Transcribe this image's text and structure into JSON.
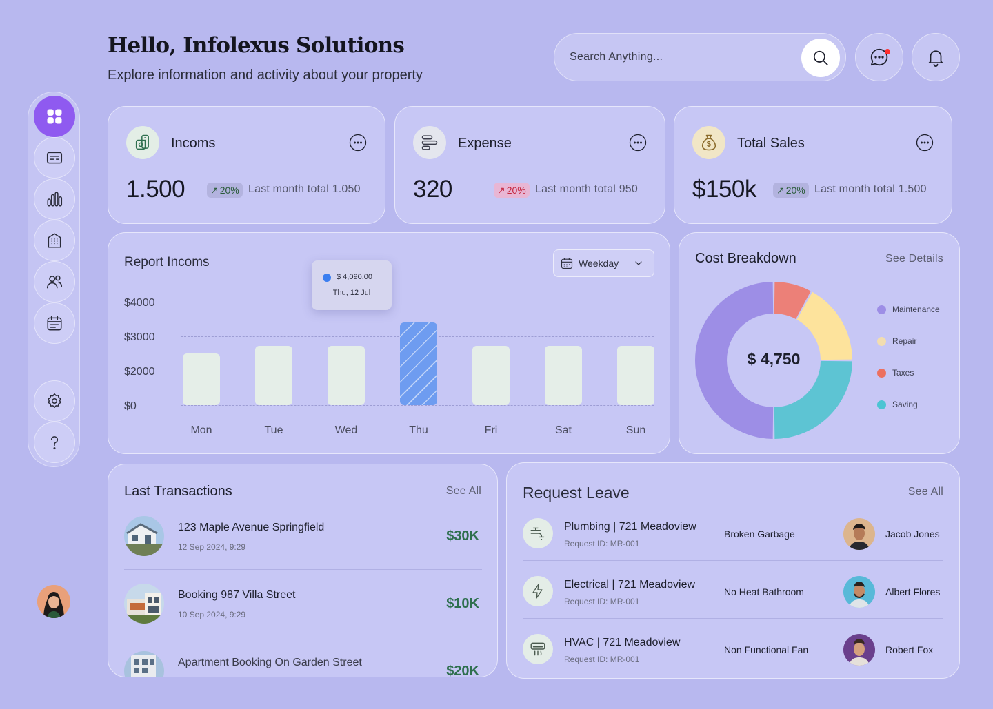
{
  "header": {
    "title": "Hello, Infolexus Solutions",
    "subtitle": "Explore information and activity about your property",
    "search_placeholder": "Search Anything..."
  },
  "sidebar": {
    "items": [
      {
        "icon": "grid-icon",
        "active": true
      },
      {
        "icon": "card-icon"
      },
      {
        "icon": "chart-icon"
      },
      {
        "icon": "building-icon"
      },
      {
        "icon": "users-icon"
      },
      {
        "icon": "calendar-icon"
      }
    ],
    "bottom": [
      {
        "icon": "gear-icon"
      },
      {
        "icon": "help-icon"
      }
    ]
  },
  "stats": [
    {
      "label": "Incoms",
      "value": "1.500",
      "change": "20%",
      "trend": "up",
      "note": "Last month total 1.050"
    },
    {
      "label": "Expense",
      "value": "320",
      "change": "20%",
      "trend": "down",
      "note": "Last month total 950"
    },
    {
      "label": "Total Sales",
      "value": "$150k",
      "change": "20%",
      "trend": "up",
      "note": "Last month total 1.500"
    }
  ],
  "report": {
    "title": "Report Incoms",
    "filter": "Weekday",
    "tooltip": {
      "value": "$ 4,090.00",
      "date": "Thu, 12 Jul"
    }
  },
  "chart_data": {
    "type": "bar",
    "categories": [
      "Mon",
      "Tue",
      "Wed",
      "Thu",
      "Fri",
      "Sat",
      "Sun"
    ],
    "values": [
      2000,
      2300,
      2300,
      3200,
      2300,
      2300,
      2300
    ],
    "highlight": "Thu",
    "yticks": [
      "$4000",
      "$3000",
      "$2000",
      "$0"
    ],
    "ylim": [
      0,
      4000
    ],
    "grid": true,
    "colors": {
      "bar": "#e5eee8",
      "highlight": "#6e9cf0"
    }
  },
  "cost": {
    "title": "Cost Breakdown",
    "see_details": "See Details",
    "total": "$ 4,750",
    "segments": [
      {
        "name": "Maintenance",
        "color": "#9d8ee6",
        "share": 0.5
      },
      {
        "name": "Repair",
        "color": "#fde39c",
        "share": 0.17
      },
      {
        "name": "Taxes",
        "color": "#ec8078",
        "share": 0.08
      },
      {
        "name": "Saving",
        "color": "#5dc4d3",
        "share": 0.25
      }
    ]
  },
  "transactions": {
    "title": "Last Transactions",
    "see_all": "See All",
    "items": [
      {
        "title": "123 Maple Avenue Springfield",
        "date": "12 Sep 2024, 9:29",
        "amount": "$30K"
      },
      {
        "title": "Booking 987 Villa Street",
        "date": "10 Sep 2024, 9:29",
        "amount": "$10K"
      },
      {
        "title": "Apartment Booking On Garden Street",
        "date": "",
        "amount": "$20K"
      }
    ]
  },
  "leave": {
    "title": "Request Leave",
    "see_all": "See All",
    "items": [
      {
        "title": "Plumbing | 721 Meadoview",
        "request_id": "Request ID: MR-001",
        "issue": "Broken Garbage",
        "person": "Jacob Jones",
        "icon": "faucet-icon"
      },
      {
        "title": "Electrical | 721 Meadoview",
        "request_id": "Request ID: MR-001",
        "issue": "No Heat Bathroom",
        "person": "Albert Flores",
        "icon": "bolt-icon"
      },
      {
        "title": "HVAC | 721 Meadoview",
        "request_id": "Request ID: MR-001",
        "issue": "Non Functional Fan",
        "person": "Robert Fox",
        "icon": "ac-icon"
      }
    ]
  }
}
